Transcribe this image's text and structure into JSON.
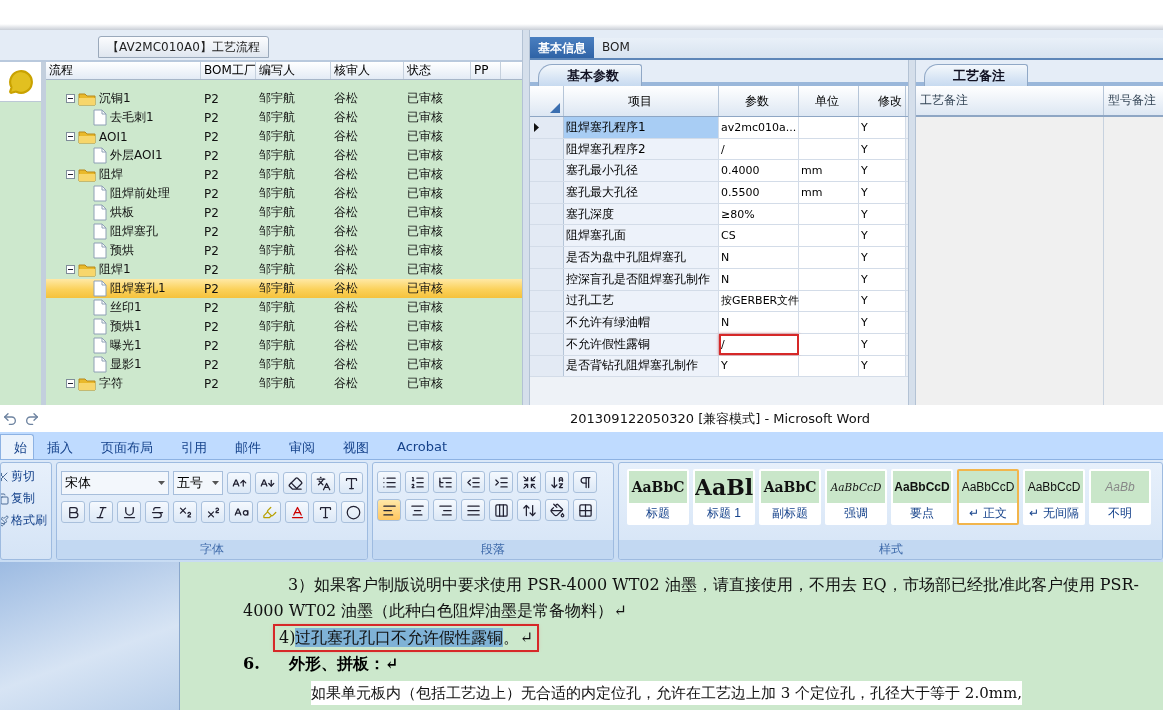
{
  "top_app": {
    "flow_panel": {
      "title": "【AV2MC010A0】工艺流程",
      "columns": [
        "流程",
        "BOM工厂",
        "编写人",
        "核审人",
        "状态",
        "PP"
      ],
      "tree": [
        {
          "kind": "folder",
          "name": "沉铜1",
          "expanded": true,
          "selected": false,
          "cells": [
            "P2",
            "邹宇航",
            "谷松",
            "已审核"
          ],
          "children": [
            {
              "kind": "file",
              "name": "去毛刺1",
              "selected": false,
              "cells": [
                "P2",
                "邹宇航",
                "谷松",
                "已审核"
              ]
            }
          ]
        },
        {
          "kind": "folder",
          "name": "AOI1",
          "expanded": true,
          "selected": false,
          "cells": [
            "P2",
            "邹宇航",
            "谷松",
            "已审核"
          ],
          "children": [
            {
              "kind": "file",
              "name": "外层AOI1",
              "selected": false,
              "cells": [
                "P2",
                "邹宇航",
                "谷松",
                "已审核"
              ]
            }
          ]
        },
        {
          "kind": "folder",
          "name": "阻焊",
          "expanded": true,
          "selected": false,
          "cells": [
            "P2",
            "邹宇航",
            "谷松",
            "已审核"
          ],
          "children": [
            {
              "kind": "file",
              "name": "阻焊前处理",
              "selected": false,
              "cells": [
                "P2",
                "邹宇航",
                "谷松",
                "已审核"
              ]
            },
            {
              "kind": "file",
              "name": "烘板",
              "selected": false,
              "cells": [
                "P2",
                "邹宇航",
                "谷松",
                "已审核"
              ]
            },
            {
              "kind": "file",
              "name": "阻焊塞孔",
              "selected": false,
              "cells": [
                "P2",
                "邹宇航",
                "谷松",
                "已审核"
              ]
            },
            {
              "kind": "file",
              "name": "预烘",
              "selected": false,
              "cells": [
                "P2",
                "邹宇航",
                "谷松",
                "已审核"
              ]
            }
          ]
        },
        {
          "kind": "folder",
          "name": "阻焊1",
          "expanded": true,
          "selected": false,
          "cells": [
            "P2",
            "邹宇航",
            "谷松",
            "已审核"
          ],
          "children": [
            {
              "kind": "file",
              "name": "阻焊塞孔1",
              "selected": true,
              "cells": [
                "P2",
                "邹宇航",
                "谷松",
                "已审核"
              ]
            },
            {
              "kind": "file",
              "name": "丝印1",
              "selected": false,
              "cells": [
                "P2",
                "邹宇航",
                "谷松",
                "已审核"
              ]
            },
            {
              "kind": "file",
              "name": "预烘1",
              "selected": false,
              "cells": [
                "P2",
                "邹宇航",
                "谷松",
                "已审核"
              ]
            },
            {
              "kind": "file",
              "name": "曝光1",
              "selected": false,
              "cells": [
                "P2",
                "邹宇航",
                "谷松",
                "已审核"
              ]
            },
            {
              "kind": "file",
              "name": "显影1",
              "selected": false,
              "cells": [
                "P2",
                "邹宇航",
                "谷松",
                "已审核"
              ]
            }
          ]
        },
        {
          "kind": "folder",
          "name": "字符",
          "expanded": true,
          "selected": false,
          "cells": [
            "P2",
            "邹宇航",
            "谷松",
            "已审核"
          ]
        }
      ]
    },
    "params_panel": {
      "tabs": [
        {
          "label": "基本信息",
          "selected": true
        },
        {
          "label": "BOM",
          "selected": false
        }
      ],
      "sub_tab": "基本参数",
      "columns": [
        "项目",
        "参数",
        "单位",
        "修改"
      ],
      "rows": [
        {
          "item": "阻焊塞孔程序1",
          "value": "av2mc010a...",
          "modified": "Y",
          "selected": true,
          "highlighted": false
        },
        {
          "item": "阻焊塞孔程序2",
          "value": "/",
          "modified": "Y",
          "selected": false,
          "highlighted": false
        },
        {
          "item": "塞孔最小孔径",
          "value": "0.4000",
          "unit": "mm",
          "modified": "Y",
          "selected": false,
          "highlighted": false
        },
        {
          "item": "塞孔最大孔径",
          "value": "0.5500",
          "unit": "mm",
          "modified": "Y",
          "selected": false,
          "highlighted": false
        },
        {
          "item": "塞孔深度",
          "value": "≥80%",
          "modified": "Y",
          "selected": false,
          "highlighted": false
        },
        {
          "item": "阻焊塞孔面",
          "value": "CS",
          "modified": "Y",
          "selected": false,
          "highlighted": false
        },
        {
          "item": "是否为盘中孔阻焊塞孔",
          "value": "N",
          "modified": "Y",
          "selected": false,
          "highlighted": false
        },
        {
          "item": "控深盲孔是否阻焊塞孔制作",
          "value": "N",
          "modified": "Y",
          "selected": false,
          "highlighted": false
        },
        {
          "item": "过孔工艺",
          "value": "按GERBER文件",
          "modified": "Y",
          "selected": false,
          "highlighted": false
        },
        {
          "item": "不允许有绿油帽",
          "value": "N",
          "modified": "Y",
          "selected": false,
          "highlighted": false
        },
        {
          "item": "不允许假性露铜",
          "value": "/",
          "modified": "Y",
          "selected": false,
          "highlighted": true
        },
        {
          "item": "是否背钻孔阻焊塞孔制作",
          "value": "Y",
          "modified": "Y",
          "selected": false,
          "highlighted": false
        }
      ]
    },
    "notes_panel": {
      "sub_tab": "工艺备注",
      "columns": [
        "工艺备注",
        "型号备注"
      ]
    }
  },
  "word": {
    "title": "201309122050320 [兼容模式] - Microsoft Word",
    "tabs": [
      {
        "label": "始",
        "selected": true
      },
      {
        "label": "插入",
        "selected": false
      },
      {
        "label": "页面布局",
        "selected": false
      },
      {
        "label": "引用",
        "selected": false
      },
      {
        "label": "邮件",
        "selected": false
      },
      {
        "label": "审阅",
        "selected": false
      },
      {
        "label": "视图",
        "selected": false
      },
      {
        "label": "Acrobat",
        "selected": false
      }
    ],
    "clipboard": [
      "剪切",
      "复制",
      "格式刷"
    ],
    "font_group": {
      "label": "字体",
      "font": "宋体",
      "size": "五号",
      "row1": [
        {
          "kind": "grow"
        },
        {
          "kind": "shrink"
        },
        {
          "kind": "clear"
        },
        {
          "kind": "phonetic"
        },
        {
          "kind": "border"
        }
      ],
      "row2": [
        {
          "kind": "bold"
        },
        {
          "kind": "italic"
        },
        {
          "kind": "underline"
        },
        {
          "kind": "strike"
        },
        {
          "kind": "sub"
        },
        {
          "kind": "sup"
        },
        {
          "kind": "case"
        },
        {
          "kind": "highlight"
        },
        {
          "kind": "color"
        },
        {
          "kind": "shade"
        },
        {
          "kind": "enclose"
        }
      ]
    },
    "paragraph_group": {
      "label": "段落",
      "row1": [
        {
          "kind": "bullets",
          "selected": false
        },
        {
          "kind": "numbering",
          "selected": false
        },
        {
          "kind": "multilevel",
          "selected": false
        },
        {
          "kind": "outdent",
          "selected": false
        },
        {
          "kind": "indent",
          "selected": false
        },
        {
          "kind": "asian",
          "selected": false
        },
        {
          "kind": "sort",
          "selected": false
        },
        {
          "kind": "marks",
          "selected": false
        }
      ],
      "row2": [
        {
          "kind": "left",
          "selected": true
        },
        {
          "kind": "center",
          "selected": false
        },
        {
          "kind": "right",
          "selected": false
        },
        {
          "kind": "justify",
          "selected": false
        },
        {
          "kind": "distribute",
          "selected": false
        },
        {
          "kind": "spacing",
          "selected": false
        },
        {
          "kind": "shading",
          "selected": false
        },
        {
          "kind": "borders",
          "selected": false
        }
      ]
    },
    "styles_group": {
      "label": "样式",
      "styles": [
        {
          "kind": "title",
          "preview": "AaBbC",
          "name": "标题",
          "selected": false
        },
        {
          "kind": "heading",
          "preview": "AaBl",
          "name": "标题 1",
          "selected": false
        },
        {
          "kind": "subtitle",
          "preview": "AaBbC",
          "name": "副标题",
          "selected": false
        },
        {
          "kind": "emphasis",
          "preview": "AaBbCcD",
          "name": "强调",
          "selected": false
        },
        {
          "kind": "strong",
          "preview": "AaBbCcD",
          "name": "要点",
          "selected": false
        },
        {
          "kind": "normal",
          "preview": "AaBbCcD",
          "name": "↵ 正文",
          "selected": true
        },
        {
          "kind": "normal",
          "preview": "AaBbCcD",
          "name": "↵ 无间隔",
          "selected": false
        },
        {
          "kind": "subtle",
          "preview": "AaBb",
          "name": "不明",
          "selected": false
        }
      ]
    },
    "document": {
      "paragraph_3": "3）如果客户制版说明中要求使用 PSR-4000  WT02 油墨，请直接使用，不用去 EQ，市场部已经批准此客户使用 PSR-4000 WT02  油墨（此种白色阻焊油墨是常备物料）↵",
      "paragraph_4": {
        "prefix": "4)",
        "selected_text": "过孔塞孔孔口不允许假性露铜",
        "suffix": "。↵",
        "boxed": true
      },
      "heading": {
        "number": "6.",
        "text": "外形、拼板：↵"
      },
      "paragraph_5": "如果单元板内（包括工艺边上）无合适的内定位孔，允许在工艺边上加 3 个定位孔，孔径大于等于 2.0mm,"
    }
  }
}
